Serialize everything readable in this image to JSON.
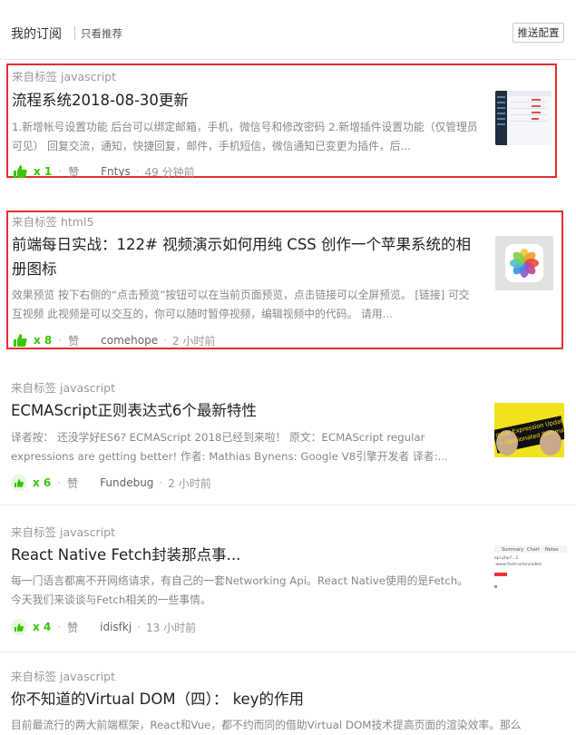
{
  "header": {
    "title": "我的订阅",
    "only_recommended": "只看推荐",
    "push_config": "推送配置"
  },
  "colors": {
    "highlight_border": "#e62e2e",
    "like_green": "#37c700"
  },
  "items": [
    {
      "tag": "来自标签 javascript",
      "title": "流程系统2018-08-30更新",
      "desc": "1.新增帐号设置功能 后台可以绑定邮箱，手机，微信号和修改密码 2.新增插件设置功能（仅管理员可见） 回复交流，通知，快捷回复，邮件，手机短信，微信通知已变更为插件，后...",
      "likes": "x 1",
      "like_word": "赞",
      "author": "Fntys",
      "time": "49 分钟前",
      "highlighted": true,
      "thumb_icon": "dashboard-screenshot"
    },
    {
      "tag": "来自标签 html5",
      "title": "前端每日实战：122# 视频演示如何用纯 CSS 创作一个苹果系统的相册图标",
      "desc": "效果预览 按下右侧的“点击预览”按钮可以在当前页面预览，点击链接可以全屏预览。 [链接] 可交互视频 此视频是可以交互的，你可以随时暂停视频，编辑视频中的代码。 请用...",
      "likes": "x 8",
      "like_word": "赞",
      "author": "comehope",
      "time": "2 小时前",
      "highlighted": true,
      "thumb_icon": "photos-app-icon"
    },
    {
      "tag": "来自标签 javascript",
      "title": "ECMAScript正则表达式6个最新特性",
      "desc": "译者按： 还没学好ES6? ECMAScript 2018已经到来啦！ 原文：ECMAScript regular expressions are getting better! 作者: Mathias Bynens: Google V8引擎开发者 译者:...",
      "likes": "x 6",
      "like_word": "赞",
      "author": "Fundebug",
      "time": "2 小时前",
      "highlighted": false,
      "thumb_icon": "regex-update-banner",
      "thumb_text_1": "gular Expression Update",
      "thumb_text_2": "n Opinionated Summary"
    },
    {
      "tag": "来自标签 javascript",
      "title": "React Native Fetch封装那点事...",
      "desc": "每一门语言都离不开网络请求，有自己的一套Networking Api。React Native使用的是Fetch。 今天我们来谈谈与Fetch相关的一些事情。",
      "likes": "x 4",
      "like_word": "赞",
      "author": "idisfkj",
      "time": "13 小时前",
      "highlighted": false,
      "thumb_icon": "network-panel-screenshot",
      "thumb_tabs": [
        "Summary",
        "Chart",
        "Notes"
      ],
      "thumb_line_1": "api.php?...1",
      "thumb_line_2": "-www-form-urlencoded"
    },
    {
      "tag": "来自标签 javascript",
      "title": "你不知道的Virtual DOM（四）： key的作用",
      "desc": "目前最流行的两大前端框架，React和Vue，都不约而同的借助Virtual DOM技术提高页面的渲染效率。那么",
      "likes": "",
      "like_word": "",
      "author": "",
      "time": "",
      "highlighted": false,
      "thumb_icon": ""
    }
  ]
}
